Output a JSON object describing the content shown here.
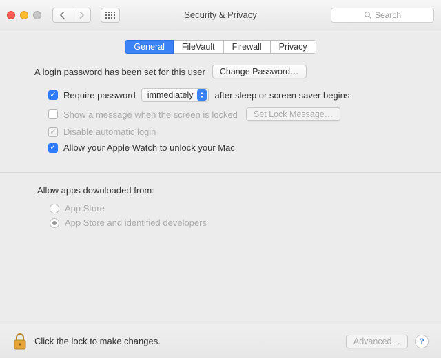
{
  "window": {
    "title": "Security & Privacy",
    "search_placeholder": "Search"
  },
  "tabs": {
    "general": "General",
    "filevault": "FileVault",
    "firewall": "Firewall",
    "privacy": "Privacy",
    "active": "General"
  },
  "general": {
    "login_password_text": "A login password has been set for this user",
    "change_password_btn": "Change Password…",
    "require_password_label_pre": "Require password",
    "require_password_delay": "immediately",
    "require_password_label_post": "after sleep or screen saver begins",
    "require_password_checked": true,
    "show_message_label": "Show a message when the screen is locked",
    "show_message_checked": false,
    "set_lock_message_btn": "Set Lock Message…",
    "disable_auto_login_label": "Disable automatic login",
    "disable_auto_login_checked": true,
    "apple_watch_label": "Allow your Apple Watch to unlock your Mac",
    "apple_watch_checked": true
  },
  "download_sources": {
    "heading": "Allow apps downloaded from:",
    "options": [
      {
        "label": "App Store",
        "selected": false
      },
      {
        "label": "App Store and identified developers",
        "selected": true
      }
    ]
  },
  "footer": {
    "lock_text": "Click the lock to make changes.",
    "advanced_btn": "Advanced…"
  }
}
